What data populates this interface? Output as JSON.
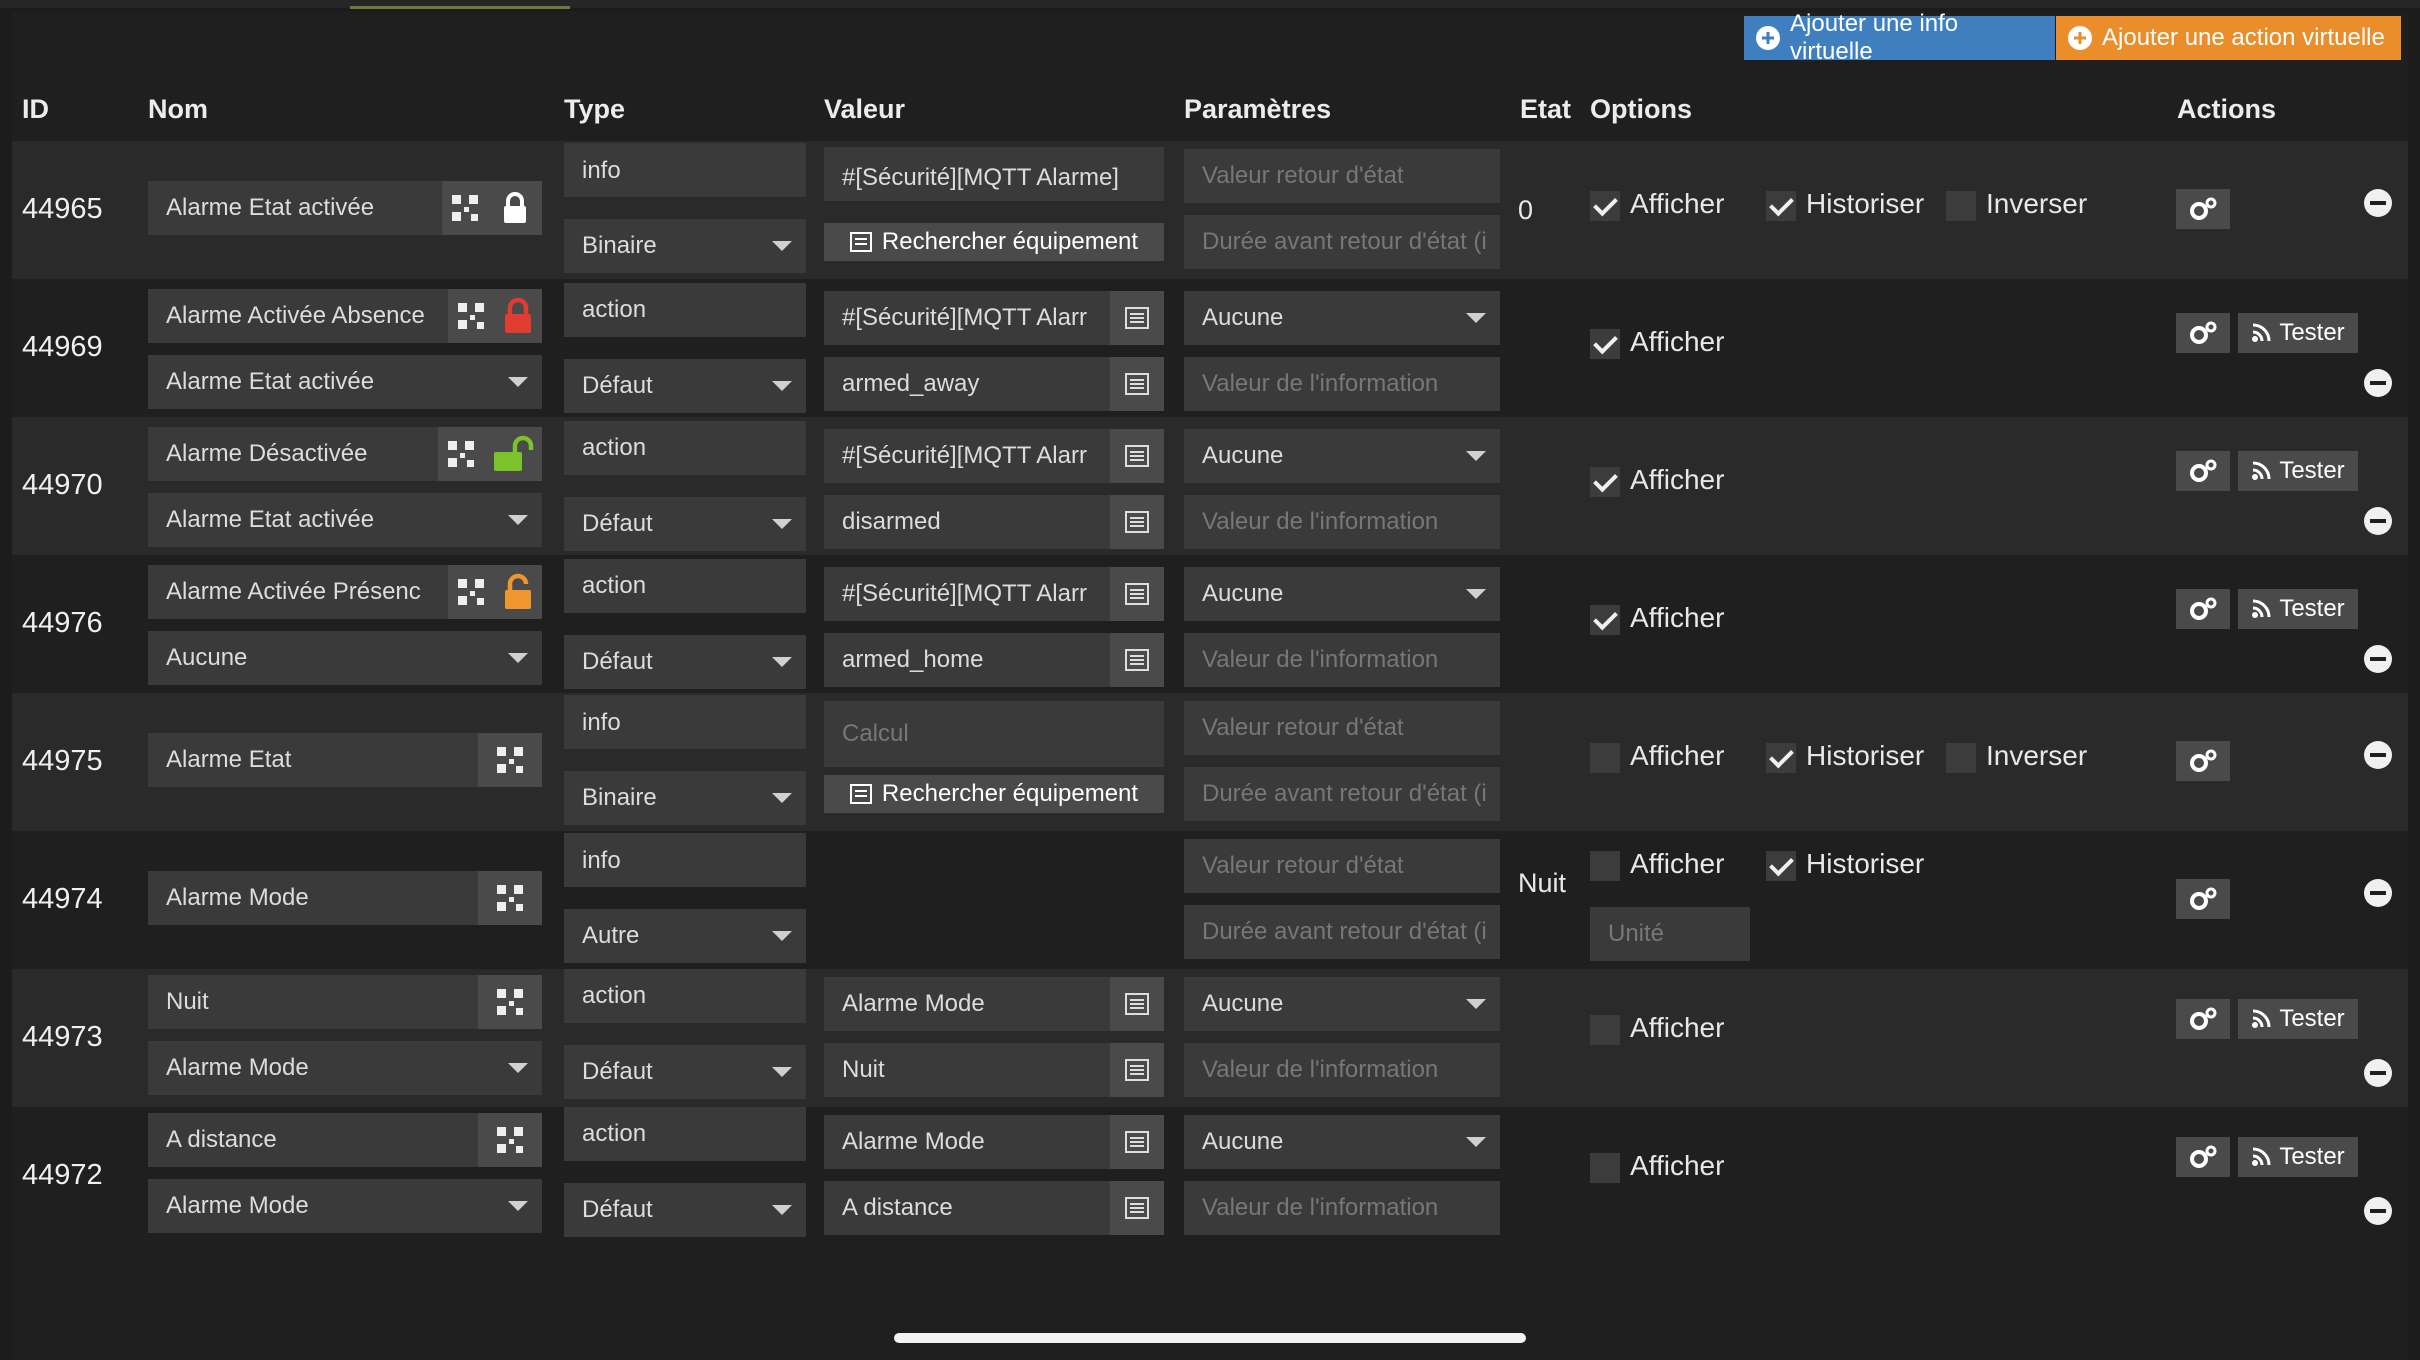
{
  "toolbar": {
    "add_info_label": "Ajouter une info virtuelle",
    "add_action_label": "Ajouter une action virtuelle"
  },
  "headers": {
    "id": "ID",
    "nom": "Nom",
    "type": "Type",
    "valeur": "Valeur",
    "parametres": "Paramètres",
    "etat": "Etat",
    "options": "Options",
    "actions": "Actions"
  },
  "labels": {
    "rechercher": "Rechercher équipement",
    "afficher": "Afficher",
    "historiser": "Historiser",
    "inverser": "Inverser",
    "tester": "Tester",
    "ph_valeur_retour": "Valeur retour d'état",
    "ph_duree": "Durée avant retour d'état (i",
    "ph_valeur_info": "Valeur de l'information",
    "ph_calcul": "Calcul",
    "ph_unite": "Unité"
  },
  "colors": {
    "add_info_button": "#3f7fbf",
    "add_action_button": "#e98e2b",
    "lock_red": "#e03c31",
    "lock_green": "#7cc22b",
    "lock_orange": "#f0962e"
  },
  "rows": [
    {
      "id": "44965",
      "name": "Alarme Etat activée",
      "type": "info",
      "subtype": "Binaire",
      "valeur": "#[Sécurité][MQTT Alarme][mqttha_alarme_etat]#",
      "etat": "0",
      "afficher": true,
      "historiser": true,
      "inverser": false,
      "icon": "lock-white-icon"
    },
    {
      "id": "44969",
      "name": "Alarme Activée Absence",
      "type": "action",
      "subtype": "Défaut",
      "linked": "Alarme Etat activée",
      "valeur": "#[Sécurité][MQTT Alarr",
      "valeur2": "armed_away",
      "param": "Aucune",
      "afficher": true,
      "icon": "lock-red-icon"
    },
    {
      "id": "44970",
      "name": "Alarme Désactivée",
      "type": "action",
      "subtype": "Défaut",
      "linked": "Alarme Etat activée",
      "valeur": "#[Sécurité][MQTT Alarr",
      "valeur2": "disarmed",
      "param": "Aucune",
      "afficher": true,
      "icon": "unlock-green-icon"
    },
    {
      "id": "44976",
      "name": "Alarme Activée Présenc",
      "type": "action",
      "subtype": "Défaut",
      "linked": "Aucune",
      "valeur": "#[Sécurité][MQTT Alarr",
      "valeur2": "armed_home",
      "param": "Aucune",
      "afficher": true,
      "icon": "lock-orange-icon"
    },
    {
      "id": "44975",
      "name": "Alarme Etat",
      "type": "info",
      "subtype": "Binaire",
      "afficher": false,
      "historiser": true,
      "inverser": false
    },
    {
      "id": "44974",
      "name": "Alarme Mode",
      "type": "info",
      "subtype": "Autre",
      "etat": "Nuit",
      "afficher": false,
      "historiser": true
    },
    {
      "id": "44973",
      "name": "Nuit",
      "type": "action",
      "subtype": "Défaut",
      "linked": "Alarme Mode",
      "valeur": "Alarme Mode",
      "valeur2": "Nuit",
      "param": "Aucune",
      "afficher": false
    },
    {
      "id": "44972",
      "name": "A distance",
      "type": "action",
      "subtype": "Défaut",
      "linked": "Alarme Mode",
      "valeur": "Alarme Mode",
      "valeur2": "A distance",
      "param": "Aucune",
      "afficher": false
    }
  ]
}
